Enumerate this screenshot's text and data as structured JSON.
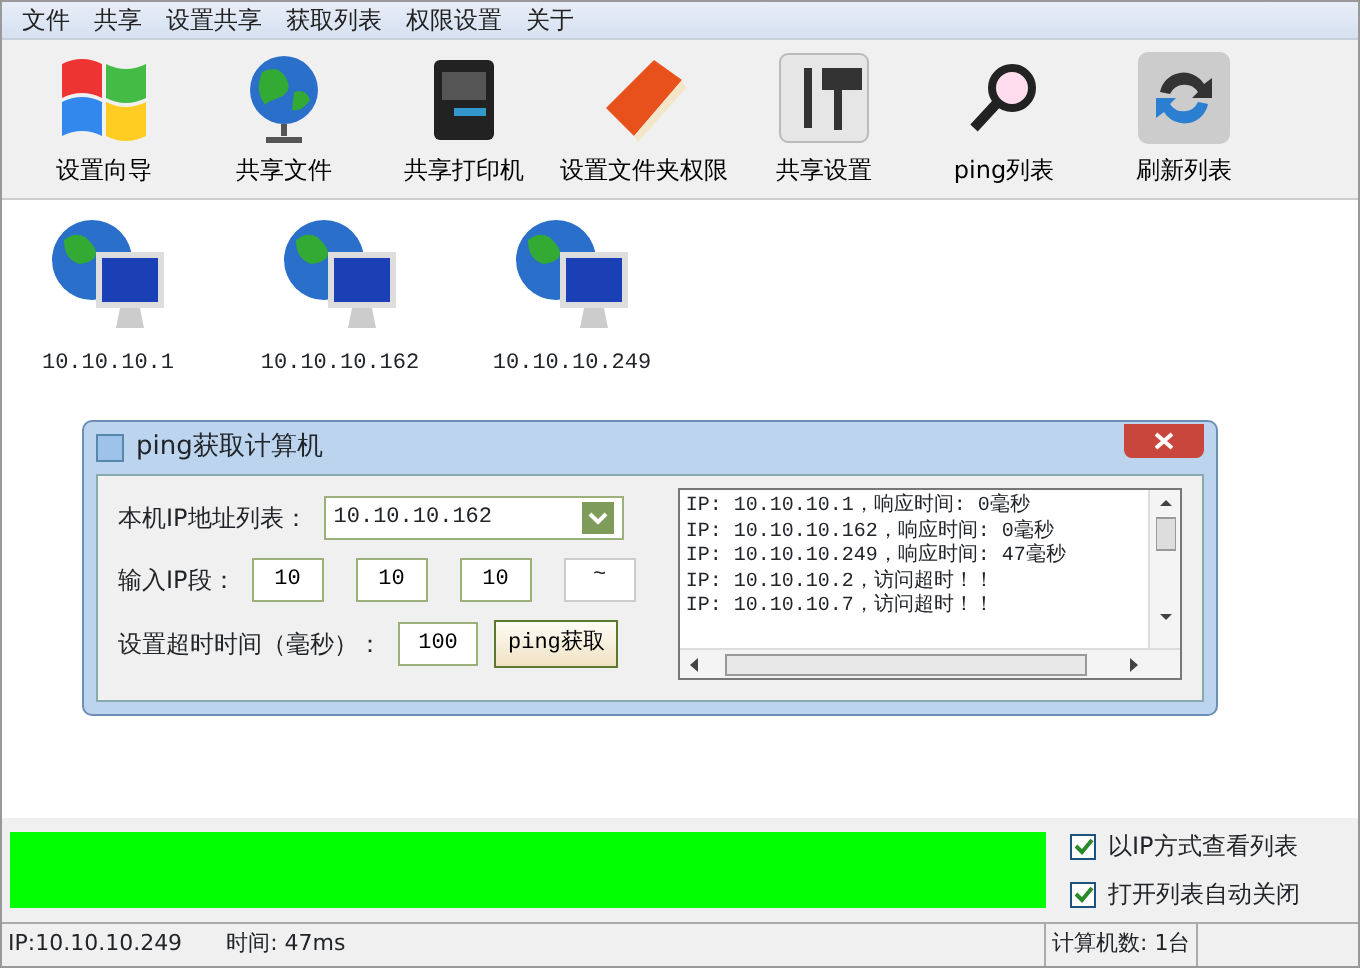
{
  "menu": [
    "文件",
    "共享",
    "设置共享",
    "获取列表",
    "权限设置",
    "关于"
  ],
  "toolbar": [
    {
      "kind": "windows",
      "label": "设置向导"
    },
    {
      "kind": "globe",
      "label": "共享文件"
    },
    {
      "kind": "printer",
      "label": "共享打印机"
    },
    {
      "kind": "folder",
      "label": "设置文件夹权限"
    },
    {
      "kind": "tools",
      "label": "共享设置"
    },
    {
      "kind": "magnifier",
      "label": "ping列表"
    },
    {
      "kind": "refresh",
      "label": "刷新列表"
    }
  ],
  "computers": [
    {
      "label": "10.10.10.1"
    },
    {
      "label": "10.10.10.162"
    },
    {
      "label": "10.10.10.249"
    }
  ],
  "dialog": {
    "title": "ping获取计算机",
    "ip_list_label": "本机IP地址列表：",
    "ip_list_value": "10.10.10.162",
    "ip_segment_label": "输入IP段：",
    "ip_segment": [
      "10",
      "10",
      "10"
    ],
    "range_separator": "~",
    "timeout_label": "设置超时时间（毫秒）：",
    "timeout_value": "100",
    "ping_button": "ping获取",
    "log": [
      "IP: 10.10.10.1，响应时间: 0毫秒",
      "IP: 10.10.10.162，响应时间: 0毫秒",
      "IP: 10.10.10.249，响应时间: 47毫秒",
      "IP: 10.10.10.2，访问超时！！",
      "IP: 10.10.10.7，访问超时！！"
    ]
  },
  "progress": {
    "level": 1
  },
  "options": [
    {
      "label": "以IP方式查看列表",
      "checked": true
    },
    {
      "label": "打开列表自动关闭",
      "checked": true
    }
  ],
  "status_bar": {
    "ip": "IP:10.10.10.249",
    "time": "时间: 47ms",
    "count": "计算机数: 1台"
  }
}
